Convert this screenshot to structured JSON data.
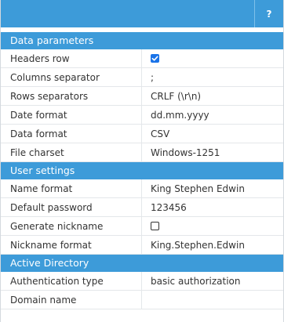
{
  "toolbar": {
    "help_label": "?"
  },
  "sections": {
    "data_parameters": {
      "title": "Data parameters",
      "headers_row": {
        "label": "Headers row",
        "checked": true
      },
      "columns_separator": {
        "label": "Columns separator",
        "value": ";"
      },
      "rows_separators": {
        "label": "Rows separators",
        "value": "CRLF (\\r\\n)"
      },
      "date_format": {
        "label": "Date format",
        "value": "dd.mm.yyyy"
      },
      "data_format": {
        "label": "Data format",
        "value": "CSV"
      },
      "file_charset": {
        "label": "File charset",
        "value": "Windows-1251"
      }
    },
    "user_settings": {
      "title": "User settings",
      "name_format": {
        "label": "Name format",
        "value": "King Stephen Edwin"
      },
      "default_password": {
        "label": "Default password",
        "value": "123456"
      },
      "generate_nickname": {
        "label": "Generate nickname",
        "checked": false
      },
      "nickname_format": {
        "label": "Nickname format",
        "value": "King.Stephen.Edwin"
      }
    },
    "active_directory": {
      "title": "Active Directory",
      "authentication_type": {
        "label": "Authentication type",
        "value": "basic authorization"
      },
      "domain_name": {
        "label": "Domain name",
        "value": ""
      }
    }
  },
  "colors": {
    "accent": "#3d9bd9",
    "checkbox_checked": "#1a73e8"
  }
}
